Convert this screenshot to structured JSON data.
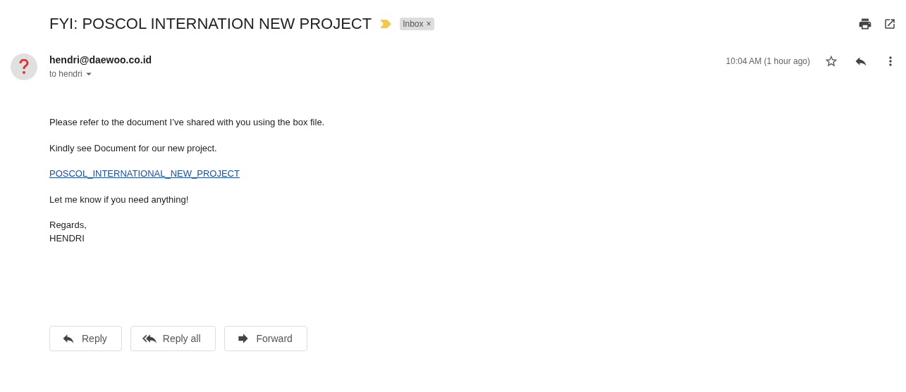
{
  "subject": "FYI: POSCOL INTERNATION NEW PROJECT",
  "label": {
    "text": "Inbox",
    "remove": "×"
  },
  "sender": {
    "email": "hendri@daewoo.co.id",
    "recipient": "to hendri"
  },
  "time": "10:04 AM (1 hour ago)",
  "starred": false,
  "body": [
    {
      "kind": "text",
      "text": "Please refer to the document I’ve shared with you using the box file."
    },
    {
      "kind": "text",
      "text": "Kindly see Document for our new project."
    },
    {
      "kind": "link",
      "text": "POSCOL_INTERNATIONAL_NEW_PROJECT"
    },
    {
      "kind": "text",
      "text": "Let me know if you need anything!"
    }
  ],
  "signature": [
    "Regards,",
    "HENDRI"
  ],
  "actions": [
    {
      "kind": "reply",
      "label": "Reply"
    },
    {
      "kind": "reply_all",
      "label": "Reply all"
    },
    {
      "kind": "forward",
      "label": "Forward"
    }
  ]
}
